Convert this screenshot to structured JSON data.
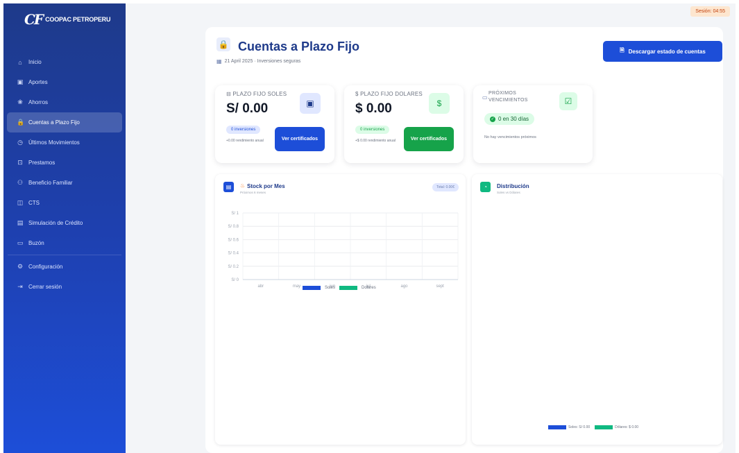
{
  "brand": {
    "logo_mark": "CF",
    "name": "COOPAC PETROPERU"
  },
  "sidebar": {
    "items": [
      {
        "label": "Inicio",
        "icon": "home-icon",
        "glyph": "⌂"
      },
      {
        "label": "Aportes",
        "icon": "card-icon",
        "glyph": "▣"
      },
      {
        "label": "Ahorros",
        "icon": "gift-icon",
        "glyph": "❀"
      },
      {
        "label": "Cuentas a Plazo Fijo",
        "icon": "lock-icon",
        "glyph": "🔒",
        "active": true
      },
      {
        "label": "Últimos Movimientos",
        "icon": "clock-icon",
        "glyph": "◷"
      },
      {
        "label": "Prestamos",
        "icon": "briefcase-icon",
        "glyph": "⊡"
      },
      {
        "label": "Beneficio Familiar",
        "icon": "people-icon",
        "glyph": "⚇"
      },
      {
        "label": "CTS",
        "icon": "wallet-icon",
        "glyph": "◫"
      },
      {
        "label": "Simulación de Crédito",
        "icon": "calculator-icon",
        "glyph": "▤"
      },
      {
        "label": "Buzón",
        "icon": "inbox-icon",
        "glyph": "▭"
      },
      {
        "label": "Configuración",
        "icon": "gear-icon",
        "glyph": "⚙"
      },
      {
        "label": "Cerrar sesión",
        "icon": "logout-icon",
        "glyph": "⇥"
      }
    ]
  },
  "session": {
    "label": "Sesión: 04:55"
  },
  "header": {
    "title": "Cuentas a Plazo Fijo",
    "subtitle": "21 April 2025 · Inversiones seguras",
    "download_label": "Descargar estado de cuentas"
  },
  "cards": {
    "soles": {
      "label": "PLAZO FIJO SOLES",
      "amount": "S/ 0.00",
      "pill": "0 inversiones",
      "note": "+0.00 rendimiento anual",
      "button": "Ver certificados"
    },
    "dolares": {
      "label": "$ PLAZO FIJO DOLARES",
      "amount": "$ 0.00",
      "pill": "0 inversiones",
      "note": "+$ 0.00 rendimiento anual",
      "button": "Ver certificados"
    },
    "vencimientos": {
      "label": "PRÓXIMOS VENCIMIENTOS",
      "badge": "0 en 30 días",
      "note": "No hay vencimientos próximos"
    }
  },
  "stock_panel": {
    "title": "Stock por Mes",
    "subtitle": "Próximos 6 meses",
    "tag": "Total: 0.00€"
  },
  "dist_panel": {
    "title": "Distribución",
    "subtitle": "Soles vs Dólares",
    "legend_soles": "Soles: S/ 0.00",
    "legend_dolares": "Dólares: $ 0.00"
  },
  "colors": {
    "primary": "#1d4ed8",
    "green": "#16a34a",
    "soles": "#1d4ed8",
    "dolares": "#10b981"
  },
  "chart_data": {
    "type": "bar",
    "title": "Stock por Mes",
    "categories": [
      "abr",
      "may",
      "jun",
      "jul",
      "ago",
      "sept"
    ],
    "series": [
      {
        "name": "Soles",
        "values": [
          0,
          0,
          0,
          0,
          0,
          0
        ],
        "color": "#1d4ed8"
      },
      {
        "name": "Dolares",
        "values": [
          0,
          0,
          0,
          0,
          0,
          0
        ],
        "color": "#10b981"
      }
    ],
    "y_ticks": [
      "S/ 0",
      "S/ 0.2",
      "S/ 0.4",
      "S/ 0.6",
      "S/ 0.8",
      "S/ 1"
    ],
    "ylim": [
      0,
      1
    ],
    "grid": true,
    "legend": "bottom"
  }
}
